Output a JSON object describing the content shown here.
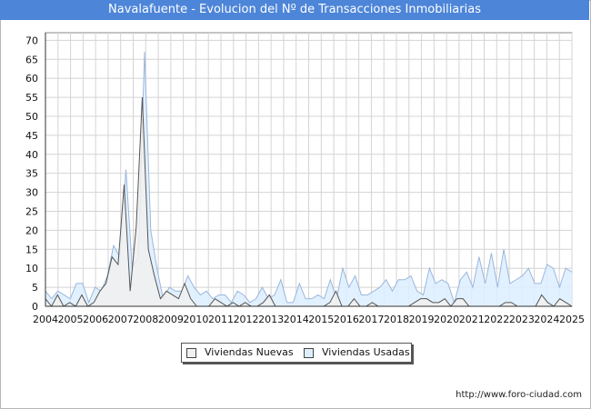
{
  "title": "Navalafuente - Evolucion del Nº de Transacciones Inmobiliarias",
  "source": "http://www.foro-ciudad.com",
  "colors": {
    "title_bar": "#4d85d9",
    "nuevas_line": "#555555",
    "nuevas_fill": "#f0f0f0",
    "usadas_line": "#9bb6dc",
    "usadas_fill": "#ddeeff",
    "grid": "#d4d4d4"
  },
  "chart_data": {
    "type": "area",
    "title": "Navalafuente - Evolucion del Nº de Transacciones Inmobiliarias",
    "xlabel": "",
    "ylabel": "",
    "x_tick_labels": [
      "2004",
      "2005",
      "2006",
      "2007",
      "2008",
      "2009",
      "2010",
      "2011",
      "2012",
      "2013",
      "2014",
      "2015",
      "2016",
      "2017",
      "2018",
      "2019",
      "2020",
      "2021",
      "2022",
      "2023",
      "2024",
      "2025"
    ],
    "y_tick_labels": [
      "0",
      "5",
      "10",
      "15",
      "20",
      "25",
      "30",
      "35",
      "40",
      "45",
      "50",
      "55",
      "60",
      "65",
      "70"
    ],
    "ylim": [
      0,
      72
    ],
    "grid": true,
    "legend_position": "bottom",
    "period": "quarterly",
    "series": [
      {
        "name": "Viviendas Nuevas",
        "values": [
          2,
          0,
          3,
          0,
          1,
          0,
          3,
          0,
          1,
          4,
          6,
          13,
          11,
          32,
          4,
          21,
          55,
          15,
          8,
          2,
          4,
          3,
          2,
          6,
          2,
          0,
          0,
          0,
          2,
          1,
          0,
          1,
          0,
          1,
          0,
          0,
          1,
          3,
          0,
          0,
          0,
          0,
          0,
          0,
          0,
          0,
          0,
          1,
          4,
          0,
          0,
          2,
          0,
          0,
          1,
          0,
          0,
          0,
          0,
          0,
          0,
          1,
          2,
          2,
          1,
          1,
          2,
          0,
          2,
          2,
          0,
          0,
          0,
          0,
          0,
          0,
          1,
          1,
          0,
          0,
          0,
          0,
          3,
          1,
          0,
          2,
          1,
          0
        ]
      },
      {
        "name": "Viviendas Usadas",
        "values": [
          4,
          2,
          4,
          3,
          2,
          6,
          6,
          1,
          5,
          4,
          8,
          16,
          13,
          36,
          10,
          13,
          67,
          20,
          10,
          2,
          5,
          4,
          4,
          8,
          5,
          3,
          4,
          2,
          3,
          3,
          1,
          4,
          3,
          1,
          2,
          5,
          2,
          3,
          7,
          1,
          1,
          6,
          2,
          2,
          3,
          2,
          7,
          2,
          10,
          5,
          8,
          3,
          3,
          4,
          5,
          7,
          4,
          7,
          7,
          8,
          4,
          3,
          10,
          6,
          7,
          6,
          1,
          7,
          9,
          5,
          13,
          6,
          14,
          5,
          15,
          6,
          7,
          8,
          10,
          6,
          6,
          11,
          10,
          5,
          10,
          9
        ]
      }
    ]
  },
  "legend": {
    "nuevas_label": "Viviendas Nuevas",
    "usadas_label": "Viviendas Usadas"
  }
}
